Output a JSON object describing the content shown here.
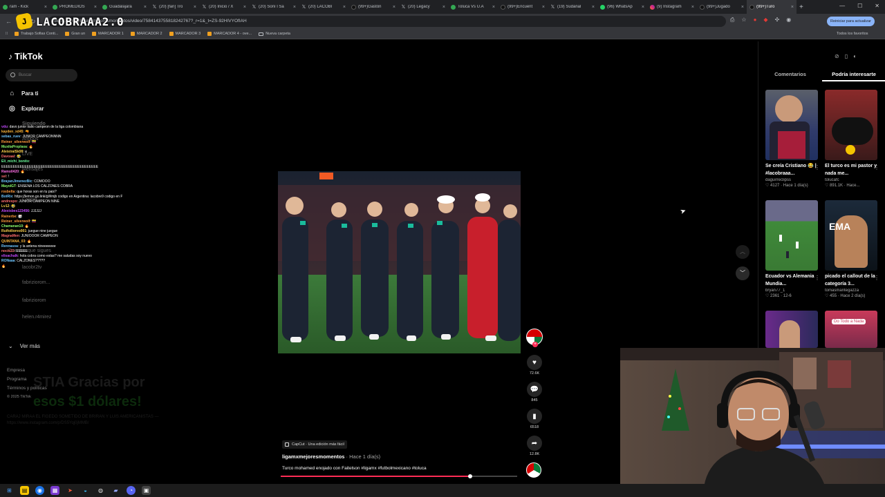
{
  "browser": {
    "tabs": [
      {
        "label": "ram - Kick",
        "icon": "kick-icon"
      },
      {
        "label": "PROMEDIOS",
        "icon": "globe-icon"
      },
      {
        "label": "Guadalajara",
        "icon": "globe-icon"
      },
      {
        "label": "(20) [fan] Tro",
        "icon": "x-icon"
      },
      {
        "label": "(20) Inicio / X",
        "icon": "x-icon"
      },
      {
        "label": "(20) Soní l Sa",
        "icon": "x-icon"
      },
      {
        "label": "(20) LACOBI",
        "icon": "x-icon"
      },
      {
        "label": "(99+)Gastón",
        "icon": "tiktok-icon"
      },
      {
        "label": "(20) Legacy",
        "icon": "x-icon"
      },
      {
        "label": "Toluca Vs U.A",
        "icon": "globe-icon"
      },
      {
        "label": "(99+)Encuent",
        "icon": "tiktok-icon"
      },
      {
        "label": "(19) Sudanal",
        "icon": "x-icon"
      },
      {
        "label": "(96) WhatsAp",
        "icon": "whatsapp-icon"
      },
      {
        "label": "(9) Instagram",
        "icon": "instagram-icon"
      },
      {
        "label": "(99+)Jugado",
        "icon": "tiktok-icon"
      },
      {
        "label": "(99+)Turo",
        "icon": "tiktok-icon",
        "active": true
      }
    ],
    "url": "tiktok.com/@ligamxmejoresmomentos/video/7584143755818242767?_r=1&_t=ZS-92HIVYOfIAH",
    "update_button": "Reiniciar para actualizar",
    "bookmarks": [
      "Trabajo Sofias Conti...",
      "Gran un",
      "MARCADOR 1",
      "MARCADOR 2",
      "MARCADOR 3",
      "MARCADOR 4 - ove...",
      "Nueva carpeta"
    ],
    "bookmarks_right": "Todos los favoritos"
  },
  "stream": {
    "logo_badge": "J",
    "logo_text": "LACOBRAAA2.0"
  },
  "sidebar": {
    "brand": "TikTok",
    "search_placeholder": "Buscar",
    "nav": [
      {
        "label": "Para ti",
        "icon": "home-icon"
      },
      {
        "label": "Explorar",
        "icon": "compass-icon"
      }
    ],
    "ghost_items": [
      "Siguiendo",
      "Amigos",
      "LIVE",
      "Mensajes",
      "Cargar",
      "Cuentas que sigues",
      "lacobr2tv",
      "fabriziorom...",
      "fabriziorom",
      "fabriziorom",
      "helen.r4mirez"
    ],
    "see_more": "Ver más",
    "footer": [
      "Empresa",
      "Programa",
      "Términos y políticas",
      "© 2025 TikTok"
    ]
  },
  "overlay": {
    "donation_line1": "STIA Gracias por",
    "donation_line2": "esos $1 dólares!",
    "donation_sub": "CARAJ MIRAA EL FIGEDO SOMETIDO DE BRIRAN Y LUIS AMERICANISTAS — https://www.instagram.com/p/DS5Yqj0jMMB/"
  },
  "chat": [
    {
      "user": "vdu",
      "color": "#c54bff",
      "text": "davo junior salio campeon de la liga colombiana"
    },
    {
      "user": "kayden_xd45",
      "color": "#ffb93d",
      "text": "🔫"
    },
    {
      "user": "sebas_ruev",
      "color": "#6ec6ff",
      "text": "JUNIOR CAMPEONNNN"
    },
    {
      "user": "Reiner_silverwolf",
      "color": "#ff9a3d",
      "text": "🇨🇴"
    },
    {
      "user": "MuxitaProplaxa",
      "color": "#8cff6e",
      "text": "🔥"
    },
    {
      "user": "AleistralSk99",
      "color": "#ffd24d",
      "text": "e"
    },
    {
      "user": "Davoaal",
      "color": "#ff6e6e",
      "text": "🤣"
    },
    {
      "user": "Eli_michi_bonito",
      "color": "#6eff9d",
      "text": ""
    },
    {
      "user": "",
      "color": "#ffffff",
      "text": "EEEEEEEEEEEEEEEEEEEEEEEEEEEEEEEEEEEEEEEEEE"
    },
    {
      "user": "Ramo0420",
      "color": "#ff6ee7",
      "text": "🔥"
    },
    {
      "user": "sel",
      "color": "#ff6e6e",
      "text": "!"
    },
    {
      "user": "BrayanJimenezBic",
      "color": "#6ec6ff",
      "text": "COMOOO"
    },
    {
      "user": "MayolGT",
      "color": "#8cff6e",
      "text": "ENSEÑA LOS CALZONES COBRA"
    },
    {
      "user": "rosbelta",
      "color": "#ff9a3d",
      "text": "que horas son en tu pais?"
    },
    {
      "user": "BotRix",
      "color": "#6ec6ff",
      "text": "https://lemon.go.link/gWmjb codigo en Argentina: lacobre9 codigo en Perú: lacobra9peru codigo en Colombia: LaCobre9Colombia"
    },
    {
      "user": "andrespo",
      "color": "#ff6e6e",
      "text": "JUNIOR CAMPEÓN NINE"
    },
    {
      "user": "Lv12",
      "color": "#ffd24d",
      "text": "🤣"
    },
    {
      "user": "Alexisbes123456",
      "color": "#c54bff",
      "text": "JJJJJJ"
    },
    {
      "user": "Rainerbe",
      "color": "#ff9a3d",
      "text": "🎲"
    },
    {
      "user": "Reiner_silverwolf",
      "color": "#ff9a3d",
      "text": "🇨🇴"
    },
    {
      "user": "Chamanan10",
      "color": "#8cff6e",
      "text": "🔥"
    },
    {
      "user": "Ruifoilioreo001",
      "color": "#ffd24d",
      "text": "juegue nine juegue"
    },
    {
      "user": "MagnaMen",
      "color": "#ff6e6e",
      "text": "JUNIOOOR CAMPEON"
    },
    {
      "user": "QUINTANA_03",
      "color": "#ffb93d",
      "text": "🔥"
    },
    {
      "user": "Rennasoa",
      "color": "#6ec6ff",
      "text": "y la antena nineeeeeee"
    },
    {
      "user": "nocie23",
      "color": "#ff6e6e",
      "text": "EEEEE"
    },
    {
      "user": "elisachalk",
      "color": "#c54bff",
      "text": "hola cobra como estas? me saludas soy nuevo"
    },
    {
      "user": "RONaaa",
      "color": "#6ec6ff",
      "text": "CALZONES?????"
    },
    {
      "user": "",
      "color": "#ffffff",
      "text": "🔥"
    }
  ],
  "video": {
    "capcut_label": "CapCut · Una edición más fácil",
    "author": "ligamxmejoresmomentos",
    "time": " · Hace 1 día(s)",
    "description": "Turco mohamed enojado con Faitelson #ligamx #futbolmexicano #toluca",
    "progress": 0.8,
    "likes": "72.6K",
    "comments": "845",
    "saves": "6518",
    "shares": "12.8K"
  },
  "right_panel": {
    "tabs": [
      "Comentarios",
      "Podría interesarte"
    ],
    "active_tab": 1,
    "cards": [
      {
        "title": "Se creía Cristiano 😂 | #lacobraaa...",
        "user": "daguirreclipss",
        "likes": "4127",
        "age": "Hace 1 día(s)"
      },
      {
        "title": "El turco es mi pastor y nada me...",
        "user": "tolucafc",
        "likes": "891.1K",
        "age": "Hace..."
      },
      {
        "title": "Ecuador vs Alemania Mundia...",
        "user": "bryan77_1",
        "likes": "2361",
        "age": "12-6"
      },
      {
        "title": "picado el callout de la categoría 3...",
        "user": "tomasmantegazza",
        "likes": "455",
        "age": "Hace 2 día(s)"
      },
      {
        "title": "",
        "user": "",
        "likes": "",
        "age": ""
      },
      {
        "title": "",
        "user": "",
        "likes": "",
        "age": ""
      }
    ],
    "card5_text": "Do Todo a Nada"
  },
  "colors": {
    "accent": "#fe2c55",
    "background": "#000000",
    "chrome": "#202124"
  }
}
